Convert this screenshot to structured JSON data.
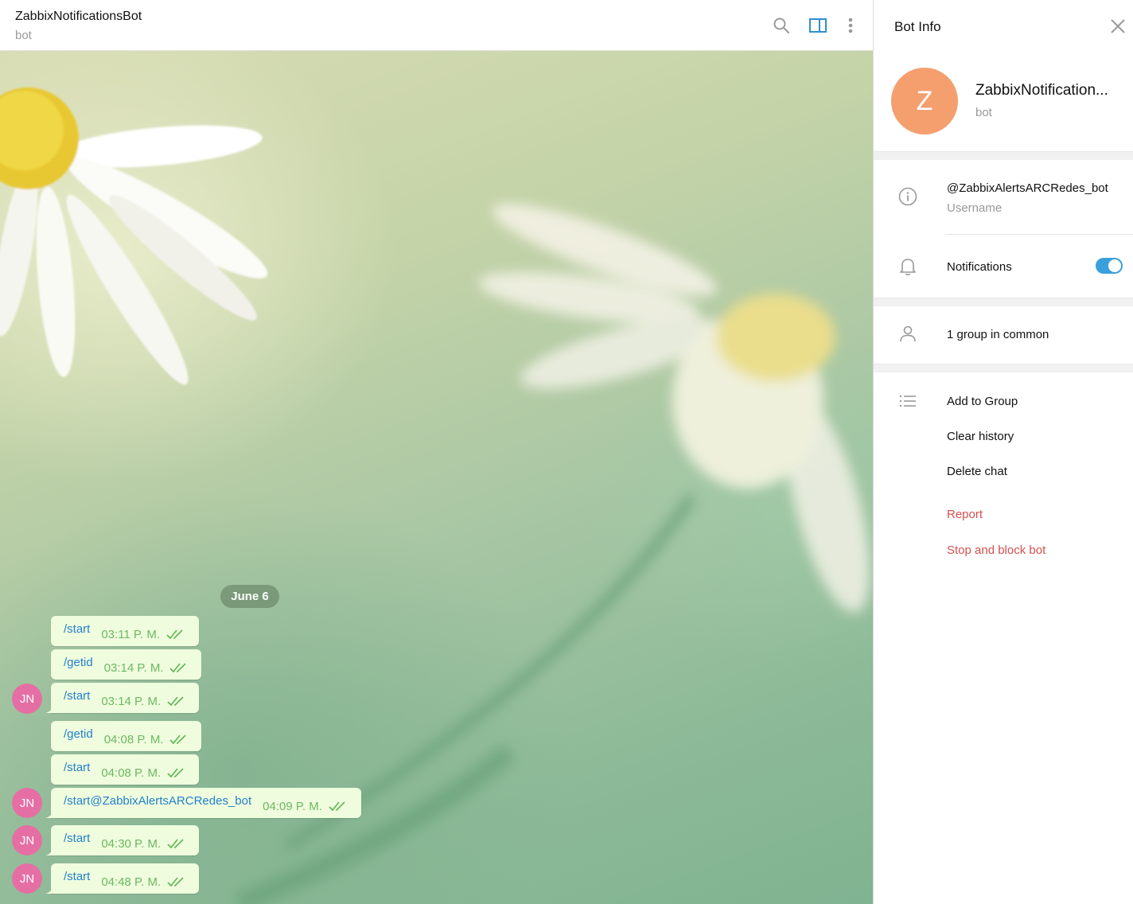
{
  "chat": {
    "title": "ZabbixNotificationsBot",
    "status": "bot",
    "date_separator": "June 6",
    "messages": [
      {
        "text": "/start",
        "time": "03:11 P. M.",
        "avatar": ""
      },
      {
        "text": "/getid",
        "time": "03:14 P. M.",
        "avatar": ""
      },
      {
        "text": "/start",
        "time": "03:14 P. M.",
        "avatar": "JN"
      },
      {
        "text": "/getid",
        "time": "04:08 P. M.",
        "avatar": ""
      },
      {
        "text": "/start",
        "time": "04:08 P. M.",
        "avatar": ""
      },
      {
        "text": "/start@ZabbixAlertsARCRedes_bot",
        "time": "04:09 P. M.",
        "avatar": "JN"
      },
      {
        "text": "/start",
        "time": "04:30 P. M.",
        "avatar": "JN"
      },
      {
        "text": "/start",
        "time": "04:48 P. M.",
        "avatar": "JN"
      }
    ]
  },
  "header_icons": [
    "search-icon",
    "sidebar-toggle-icon",
    "more-vertical-icon"
  ],
  "panel": {
    "title": "Bot Info",
    "avatar_letter": "Z",
    "bot_name": "ZabbixNotification...",
    "bot_status": "bot",
    "username": "@ZabbixAlertsARCRedes_bot",
    "username_label": "Username",
    "notifications_label": "Notifications",
    "notifications_on": true,
    "groups_in_common": "1 group in common",
    "actions": {
      "add_to_group": "Add to Group",
      "clear_history": "Clear history",
      "delete_chat": "Delete chat",
      "report": "Report",
      "stop_and_block": "Stop and block bot"
    }
  },
  "colors": {
    "accent": "#2481cc",
    "message_bg": "#effdde",
    "time_green": "#6cb85f",
    "user_avatar": "#e56fa5",
    "bot_avatar": "#f59f6f",
    "danger": "#d25050",
    "toggle_on": "#3aa0dc"
  }
}
